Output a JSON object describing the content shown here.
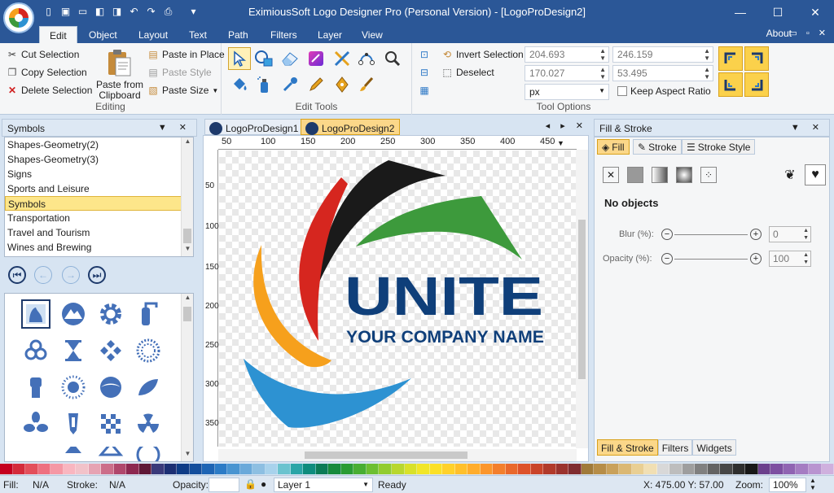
{
  "window": {
    "title": "EximiousSoft Logo Designer Pro (Personal Version) - [LogoProDesign2]",
    "controls": [
      "—",
      "☐",
      "✕"
    ]
  },
  "ribbon_tabs": [
    "Edit",
    "Object",
    "Layout",
    "Text",
    "Path",
    "Filters",
    "Layer",
    "View"
  ],
  "active_tab": "Edit",
  "about_label": "About",
  "editing": {
    "label": "Editing",
    "cut": "Cut Selection",
    "copy": "Copy Selection",
    "delete": "Delete Selection",
    "paste_from_clipboard": "Paste from Clipboard",
    "paste_line1": "Paste from",
    "paste_line2": "Clipboard",
    "paste_in_place": "Paste in Place",
    "paste_style": "Paste Style",
    "paste_size": "Paste Size"
  },
  "edit_tools": {
    "label": "Edit Tools"
  },
  "tool_options": {
    "label": "Tool Options",
    "invert_selection": "Invert Selection",
    "deselect": "Deselect",
    "x": "204.693",
    "y": "170.027",
    "width": "246.159",
    "height": "53.495",
    "unit": "px",
    "keep_aspect": "Keep Aspect Ratio"
  },
  "symbols_panel": {
    "title": "Symbols",
    "categories": [
      "Shapes-Geometry(2)",
      "Shapes-Geometry(3)",
      "Signs",
      "Sports and Leisure",
      "Symbols",
      "Transportation",
      "Travel and Tourism",
      "Wines and Brewing"
    ],
    "selected": "Symbols",
    "symbols": [
      "lake-icon",
      "mountain-icon",
      "gear-icon",
      "fire-extinguisher-icon",
      "biohazard-icon",
      "hourglass-icon",
      "diamond-dots-icon",
      "circle-dots-icon",
      "fist-icon",
      "sun-icon",
      "eye-icon",
      "leaf-icon",
      "fan-icon",
      "award-icon",
      "checker-icon",
      "radiation-icon"
    ]
  },
  "documents": {
    "tabs": [
      "LogoProDesign1",
      "LogoProDesign2"
    ],
    "active": "LogoProDesign2"
  },
  "ruler": {
    "h_ticks": [
      "50",
      "100",
      "150",
      "200",
      "250",
      "300",
      "350",
      "400",
      "450"
    ],
    "v_ticks": [
      "50",
      "100",
      "150",
      "200",
      "250",
      "300",
      "350"
    ]
  },
  "logo": {
    "headline": "UNITE",
    "tagline": "YOUR COMPANY NAME",
    "colors": {
      "navy": "#0f3f7a",
      "dark": "#1a1a1a",
      "red": "#d6261f",
      "green": "#3d9a3c",
      "orange": "#f6a01c",
      "blue": "#2d92d2"
    }
  },
  "fill_stroke_panel": {
    "title": "Fill & Stroke",
    "tabs": [
      "Fill",
      "Stroke",
      "Stroke Style"
    ],
    "active_tab": "Fill",
    "no_objects": "No objects",
    "blur_label": "Blur (%):",
    "blur_value": "0",
    "opacity_label": "Opacity (%):",
    "opacity_value": "100",
    "bottom_tabs": [
      "Fill & Stroke",
      "Filters",
      "Widgets"
    ],
    "bottom_active": "Fill & Stroke"
  },
  "palette": [
    "#c5001f",
    "#d42b3b",
    "#e34f5b",
    "#ee7080",
    "#f598a5",
    "#f9b6c0",
    "#f2c2c9",
    "#e6a3b3",
    "#cc6e8a",
    "#b0476c",
    "#8d2850",
    "#5e1736",
    "#3a3a7a",
    "#1c2f73",
    "#0e3c86",
    "#134e9c",
    "#1d64b4",
    "#2c7bc6",
    "#4894d1",
    "#6aa9da",
    "#8dbfe2",
    "#a8d2ec",
    "#6bc3cf",
    "#2aa5a7",
    "#0e8c7e",
    "#0b7b56",
    "#168a3c",
    "#2a9c34",
    "#48ae33",
    "#6cbf32",
    "#92cc30",
    "#b8d72e",
    "#d8e12a",
    "#f1e629",
    "#fbe027",
    "#ffd12b",
    "#ffc02c",
    "#ffad2d",
    "#fb962d",
    "#f37f2d",
    "#e9682c",
    "#dd522b",
    "#c9442a",
    "#b13a2b",
    "#9a332e",
    "#7f2c30",
    "#a07a3a",
    "#b68d48",
    "#c9a15b",
    "#dbb873",
    "#e9cf93",
    "#f1dfb3",
    "#d8d8d8",
    "#bdbdbd",
    "#9e9e9e",
    "#808080",
    "#636363",
    "#474747",
    "#2e2e2e",
    "#181818",
    "#6b3f8c",
    "#7d4fa1",
    "#9064b2",
    "#a57cc2",
    "#b994d0",
    "#cfb0de"
  ],
  "status": {
    "fill_label": "Fill:",
    "fill_value": "N/A",
    "stroke_label": "Stroke:",
    "stroke_value": "N/A",
    "opacity_label": "Opacity:",
    "layer": "Layer 1",
    "state": "Ready",
    "coords": "X: 475.00 Y: 57.00",
    "zoom_label": "Zoom:",
    "zoom_value": "100%"
  }
}
